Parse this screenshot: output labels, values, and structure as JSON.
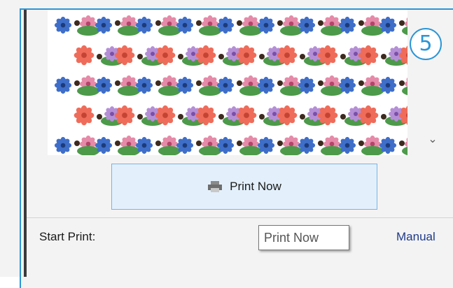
{
  "step_badge": "5",
  "preview": {
    "pattern_rows": 5
  },
  "print_button": {
    "label": "Print Now",
    "icon": "printer-icon"
  },
  "start_print": {
    "label": "Start Print:",
    "tooltip": "Print Now",
    "mode_link": "Manual"
  },
  "colors": {
    "accent": "#2b95d6",
    "button_bg": "#e3f0fb",
    "link": "#1f3a8a"
  }
}
